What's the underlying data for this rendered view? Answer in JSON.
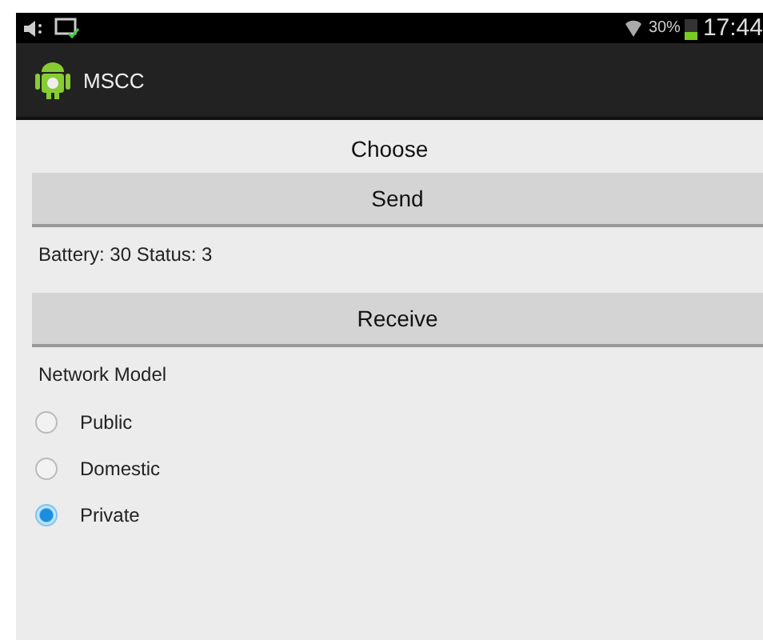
{
  "status_bar": {
    "battery_percent": "30%",
    "time": "17:44"
  },
  "action_bar": {
    "title": "MSCC"
  },
  "content": {
    "heading": "Choose",
    "send_button": "Send",
    "status_text": "Battery: 30 Status: 3",
    "receive_button": "Receive",
    "group_label": "Network Model",
    "options": [
      {
        "label": "Public",
        "selected": false
      },
      {
        "label": "Domestic",
        "selected": false
      },
      {
        "label": "Private",
        "selected": true
      }
    ]
  }
}
